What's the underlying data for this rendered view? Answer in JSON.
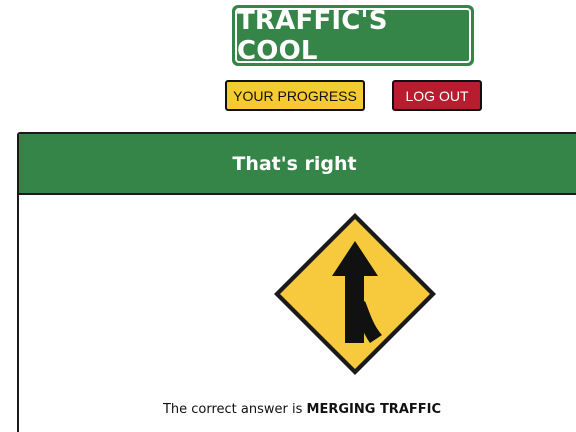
{
  "header": {
    "logo_text": "TRAFFIC'S COOL",
    "progress_button": "YOUR PROGRESS",
    "logout_button": "LOG OUT"
  },
  "result": {
    "title": "That's right",
    "answer_prefix": "The correct answer is",
    "answer_value": "MERGING TRAFFIC",
    "sign_icon": "merging-traffic-sign"
  },
  "colors": {
    "brand_green": "#358549",
    "progress_yellow": "#f6cb31",
    "logout_red": "#b71c2f",
    "sign_yellow": "#f7ca3d"
  }
}
